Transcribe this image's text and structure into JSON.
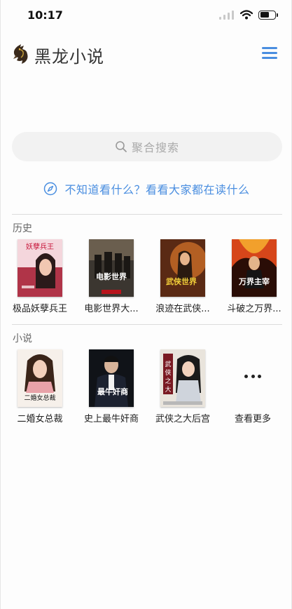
{
  "status_bar": {
    "time": "10:17"
  },
  "header": {
    "title": "黑龙小说"
  },
  "search": {
    "placeholder": "聚合搜索"
  },
  "discover": {
    "text": "不知道看什么？看看大家都在读什么"
  },
  "history": {
    "title": "历史",
    "books": [
      {
        "title": "极品妖孽兵王",
        "cover_lettering": "妖孽兵王"
      },
      {
        "title": "电影世界大...",
        "cover_lettering": "电影世界"
      },
      {
        "title": "浪迹在武侠...",
        "cover_lettering": "武侠世界"
      },
      {
        "title": "斗破之万界...",
        "cover_lettering": "万界主宰"
      }
    ]
  },
  "novels": {
    "title": "小说",
    "books": [
      {
        "title": "二婚女总裁",
        "cover_lettering": "二婚女总裁"
      },
      {
        "title": "史上最牛奸商",
        "cover_lettering": "最牛奸商"
      },
      {
        "title": "武侠之大后宫",
        "cover_lettering": "武侠之大后宫"
      }
    ],
    "more_label": "查看更多"
  },
  "colors": {
    "accent": "#4a8ee0",
    "search_bg": "#f2f2f2",
    "divider": "#dcdcdc"
  },
  "icons": [
    "wifi-icon",
    "battery-icon",
    "dragon-logo-icon",
    "menu-icon",
    "search-icon",
    "compass-icon",
    "more-icon"
  ]
}
